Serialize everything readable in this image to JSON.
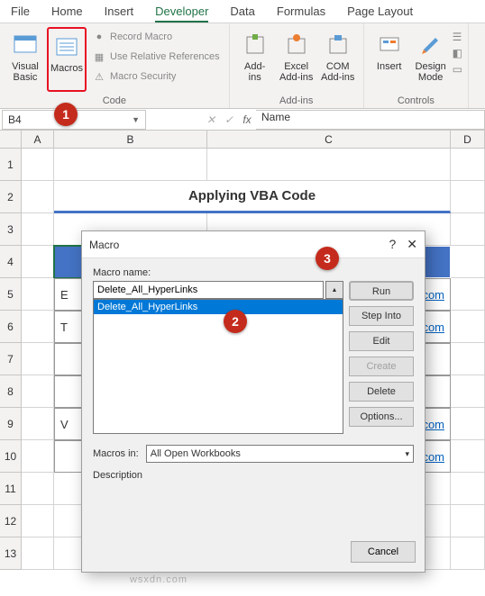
{
  "tabs": {
    "file": "File",
    "home": "Home",
    "insert": "Insert",
    "developer": "Developer",
    "data": "Data",
    "formulas": "Formulas",
    "pagelayout": "Page Layout"
  },
  "ribbon": {
    "code": {
      "visual_basic": "Visual\nBasic",
      "macros": "Macros",
      "record": "Record Macro",
      "relative": "Use Relative References",
      "security": "Macro Security",
      "group": "Code"
    },
    "addins": {
      "addins": "Add-\nins",
      "excel": "Excel\nAdd-ins",
      "com": "COM\nAdd-ins",
      "group": "Add-ins"
    },
    "controls": {
      "insert": "Insert",
      "design": "Design\nMode",
      "group": "Controls"
    }
  },
  "namebox": "B4",
  "fx": "fx",
  "formula": "Name",
  "cols": {
    "A": "A",
    "B": "B",
    "C": "C",
    "D": "D"
  },
  "widths": {
    "A": 36,
    "B": 170,
    "C": 270,
    "D": 38
  },
  "rowheads": [
    "1",
    "2",
    "3",
    "4",
    "5",
    "6",
    "7",
    "8",
    "9",
    "10",
    "11",
    "12",
    "13"
  ],
  "title": "Applying VBA Code",
  "jump_link": ".com",
  "macro": {
    "title": "Macro",
    "help": "?",
    "close": "✕",
    "name_lbl": "Macro name:",
    "name_val": "Delete_All_HyperLinks",
    "list_item": "Delete_All_HyperLinks",
    "run": "Run",
    "step": "Step Into",
    "edit": "Edit",
    "create": "Create",
    "delete": "Delete",
    "options": "Options...",
    "macros_in_lbl": "Macros in:",
    "macros_in_val": "All Open Workbooks",
    "desc": "Description",
    "cancel": "Cancel"
  },
  "markers": {
    "one": "1",
    "two": "2",
    "three": "3"
  },
  "watermark": "wsxdn.com"
}
